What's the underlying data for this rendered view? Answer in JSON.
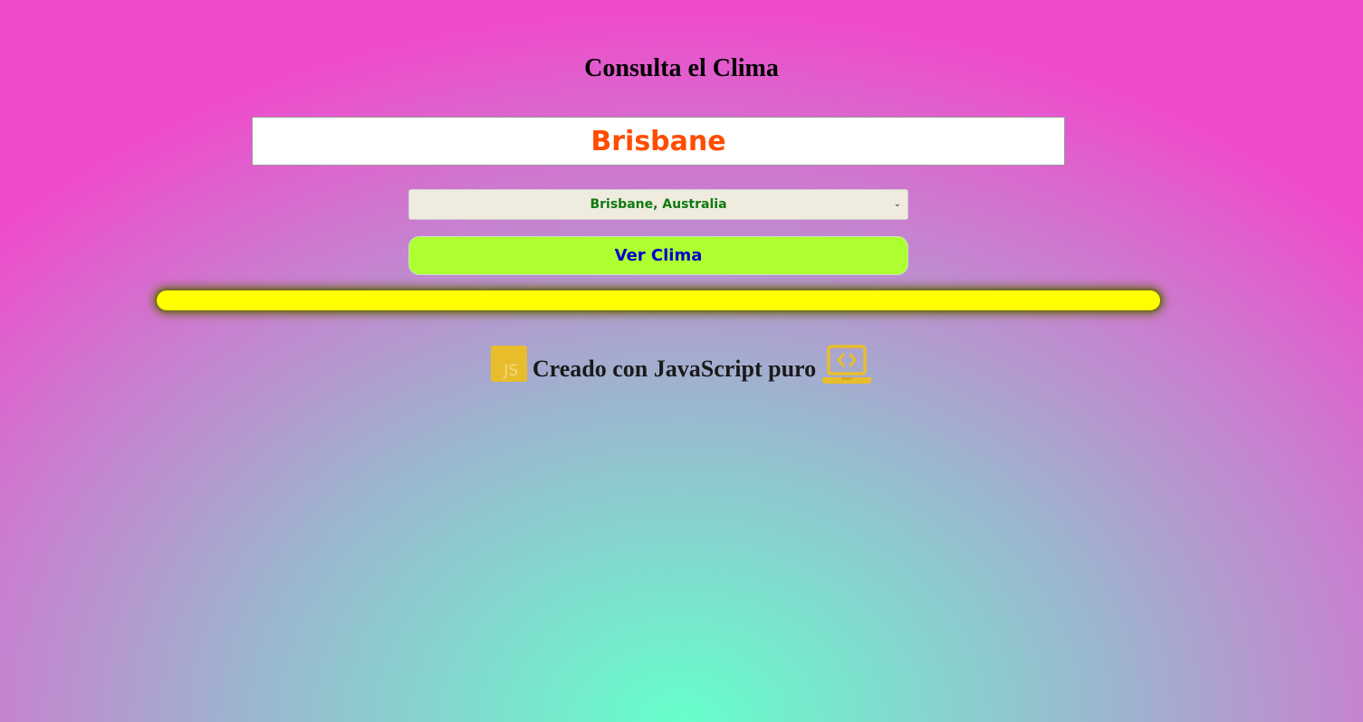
{
  "page": {
    "title": "Consulta el Clima"
  },
  "search": {
    "city_value": "Brisbane"
  },
  "city_select": {
    "selected": "Brisbane, Australia"
  },
  "button": {
    "label": "Ver Clima"
  },
  "result": {
    "text": ""
  },
  "footer": {
    "text": "Creado con JavaScript puro",
    "icons": [
      "javascript-icon",
      "laptop-code-icon"
    ]
  },
  "colors": {
    "input_text": "#ff4d00",
    "select_text": "#0f7a0f",
    "select_bg": "#efebdf",
    "button_bg": "#adff2f",
    "button_text": "#0000cc",
    "result_bar": "#ffff00",
    "icon_color": "#e8bd2c",
    "bg_center": "#66ffcc",
    "bg_edge": "#f04acc"
  }
}
